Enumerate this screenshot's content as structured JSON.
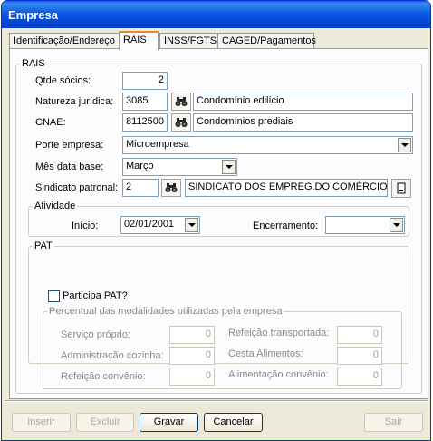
{
  "window": {
    "title": "Empresa"
  },
  "tabs": [
    {
      "label": "Identificação/Endereço"
    },
    {
      "label": "RAIS"
    },
    {
      "label": "INSS/FGTS"
    },
    {
      "label": "CAGED/Pagamentos"
    }
  ],
  "rais": {
    "group_label": "RAIS",
    "qtde_socios": {
      "label": "Qtde sócios:",
      "value": "2"
    },
    "natureza_juridica": {
      "label": "Natureza jurídica:",
      "code": "3085",
      "description": "Condomínio edilício"
    },
    "cnae": {
      "label": "CNAE:",
      "code": "8112500",
      "description": "Condomínios prediais"
    },
    "porte_empresa": {
      "label": "Porte empresa:",
      "value": "Microempresa"
    },
    "mes_data_base": {
      "label": "Mês data base:",
      "value": "Março"
    },
    "sindicato_patronal": {
      "label": "Sindicato patronal:",
      "code": "2",
      "description": "SINDICATO DOS EMPREG.DO COMÉRCIO DE"
    }
  },
  "atividade": {
    "group_label": "Atividade",
    "inicio": {
      "label": "Início:",
      "value": "02/01/2001"
    },
    "encerramento": {
      "label": "Encerramento:",
      "value": ""
    }
  },
  "pat": {
    "group_label": "PAT",
    "participa_label": "Participa PAT?",
    "participa_checked": false,
    "modalidades_label": "Percentual das modalidades utilizadas pela empresa",
    "fields": [
      {
        "label": "Serviço próprio:",
        "value": "0"
      },
      {
        "label": "Administração cozinha:",
        "value": "0"
      },
      {
        "label": "Refeição convênio:",
        "value": "0"
      },
      {
        "label": "Refeição transportada:",
        "value": "0"
      },
      {
        "label": "Cesta Alimentos:",
        "value": "0"
      },
      {
        "label": "Alimentação convênio:",
        "value": "0"
      }
    ]
  },
  "buttons": {
    "inserir": "Inserir",
    "excluir": "Excluir",
    "gravar": "Gravar",
    "cancelar": "Cancelar",
    "sair": "Sair"
  },
  "icons": {
    "lookup": "binoculars-icon",
    "sindicato_detail": "document-icon",
    "dropdown": "chevron-down-icon"
  }
}
